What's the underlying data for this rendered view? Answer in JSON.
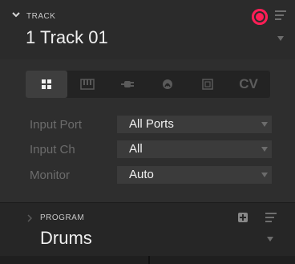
{
  "track": {
    "section_label": "TRACK",
    "name": "1 Track 01"
  },
  "tabs": [
    {
      "id": "grid",
      "icon": "grid-icon",
      "active": true
    },
    {
      "id": "keyboard",
      "icon": "keyboard-icon",
      "active": false
    },
    {
      "id": "plugin",
      "icon": "plug-icon",
      "active": false
    },
    {
      "id": "audio",
      "icon": "audio-icon",
      "active": false
    },
    {
      "id": "screen",
      "icon": "screen-icon",
      "active": false
    },
    {
      "id": "cv",
      "label": "CV",
      "active": false
    }
  ],
  "rows": [
    {
      "label": "Input Port",
      "value": "All Ports"
    },
    {
      "label": "Input Ch",
      "value": "All"
    },
    {
      "label": "Monitor",
      "value": "Auto"
    }
  ],
  "program": {
    "section_label": "PROGRAM",
    "name": "Drums"
  },
  "colors": {
    "record": "#ff1e56",
    "background": "#262626"
  }
}
